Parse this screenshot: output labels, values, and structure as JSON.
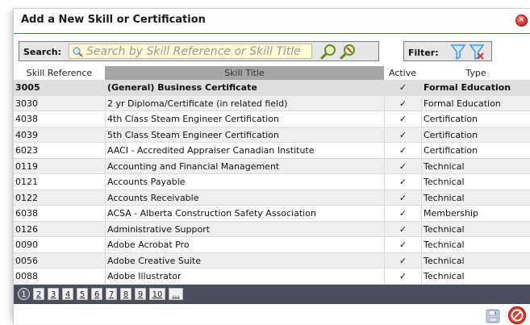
{
  "dialog": {
    "title": "Add a New Skill or Certification",
    "close_icon": "close-icon"
  },
  "search": {
    "label": "Search:",
    "placeholder": "Search by Skill Reference or Skill Title",
    "value": ""
  },
  "filter": {
    "label": "Filter:"
  },
  "table": {
    "columns": [
      "Skill Reference",
      "Skill Title",
      "Active",
      "Type"
    ],
    "rows": [
      {
        "ref": "3005",
        "title": "(General) Business Certificate",
        "active": "✓",
        "type": "Formal Education"
      },
      {
        "ref": "3030",
        "title": "2 yr Diploma/Certificate (in related field)",
        "active": "✓",
        "type": "Formal Education"
      },
      {
        "ref": "4038",
        "title": "4th Class Steam Engineer Certification",
        "active": "✓",
        "type": "Certification"
      },
      {
        "ref": "4039",
        "title": "5th Class Steam Engineer Certification",
        "active": "✓",
        "type": "Certification"
      },
      {
        "ref": "6023",
        "title": "AACI - Accredited Appraiser Canadian Institute",
        "active": "✓",
        "type": "Certification"
      },
      {
        "ref": "0119",
        "title": "Accounting and Financial Management",
        "active": "✓",
        "type": "Technical"
      },
      {
        "ref": "0121",
        "title": "Accounts Payable",
        "active": "✓",
        "type": "Technical"
      },
      {
        "ref": "0122",
        "title": "Accounts Receivable",
        "active": "✓",
        "type": "Technical"
      },
      {
        "ref": "6038",
        "title": "ACSA - Alberta Construction Safety Association",
        "active": "✓",
        "type": "Membership"
      },
      {
        "ref": "0126",
        "title": "Administrative Support",
        "active": "✓",
        "type": "Technical"
      },
      {
        "ref": "0090",
        "title": "Adobe Acrobat Pro",
        "active": "✓",
        "type": "Technical"
      },
      {
        "ref": "0056",
        "title": "Adobe Creative Suite",
        "active": "✓",
        "type": "Technical"
      },
      {
        "ref": "0088",
        "title": "Adobe Illustrator",
        "active": "✓",
        "type": "Technical"
      }
    ]
  },
  "pager": {
    "current": "1",
    "pages": [
      "1",
      "2",
      "3",
      "4",
      "5",
      "6",
      "7",
      "8",
      "9",
      "10",
      "..."
    ]
  },
  "footer": {
    "save_icon": "save-icon",
    "cancel_icon": "cancel-icon"
  },
  "colors": {
    "accent_red": "#d23a3a",
    "search_field_bg": "#fefcd6",
    "pager_bg": "#4a4d5c",
    "header_title_bg": "#a5a5a5",
    "filter_icon": "#3b9be0"
  }
}
